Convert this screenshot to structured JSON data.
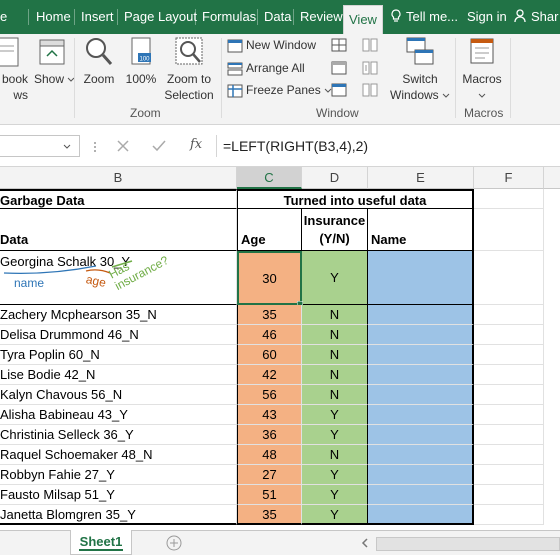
{
  "ribbon_tabs": {
    "file_partial": "e",
    "home": "Home",
    "insert": "Insert",
    "page_layout": "Page Layout",
    "formulas": "Formulas",
    "data": "Data",
    "review": "Review",
    "view": "View",
    "tell_me": "Tell me...",
    "sign_in": "Sign in",
    "share_partial": "Shar"
  },
  "ribbon": {
    "book_views_partial": "book",
    "book_views_partial2": "ws",
    "show": "Show",
    "zoom": "Zoom",
    "zoom_100": "100%",
    "zoom_to_selection_1": "Zoom to",
    "zoom_to_selection_2": "Selection",
    "zoom_group": "Zoom",
    "new_window": "New Window",
    "arrange_all": "Arrange All",
    "freeze_panes": "Freeze Panes",
    "switch_windows_1": "Switch",
    "switch_windows_2": "Windows",
    "window_group": "Window",
    "macros": "Macros",
    "macros_group": "Macros"
  },
  "formula_bar": {
    "fx": "fx",
    "formula": "=LEFT(RIGHT(B3,4),2)"
  },
  "columns": [
    "B",
    "C",
    "D",
    "E",
    "F"
  ],
  "header_row": {
    "garbage_data": "Garbage Data",
    "turned_into": "Turned into useful data"
  },
  "subheaders": {
    "data": "Data",
    "age": "Age",
    "insurance_1": "Insurance",
    "insurance_2": "(Y/N)",
    "name": "Name"
  },
  "example_row": {
    "data": "Georgina Schalk 30_Y",
    "age": "30",
    "insurance": "Y",
    "annotation_name": "name",
    "annotation_age": "age",
    "annotation_has": "Has",
    "annotation_insurance": "insurance?"
  },
  "rows": [
    {
      "data": "Zachery Mcphearson 35_N",
      "age": "35",
      "ins": "N"
    },
    {
      "data": "Delisa Drummond 46_N",
      "age": "46",
      "ins": "N"
    },
    {
      "data": "Tyra Poplin 60_N",
      "age": "60",
      "ins": "N"
    },
    {
      "data": "Lise Bodie 42_N",
      "age": "42",
      "ins": "N"
    },
    {
      "data": "Kalyn Chavous 56_N",
      "age": "56",
      "ins": "N"
    },
    {
      "data": "Alisha Babineau 43_Y",
      "age": "43",
      "ins": "Y"
    },
    {
      "data": "Christinia Selleck 36_Y",
      "age": "36",
      "ins": "Y"
    },
    {
      "data": "Raquel Schoemaker 48_N",
      "age": "48",
      "ins": "N"
    },
    {
      "data": "Robbyn Fahie 27_Y",
      "age": "27",
      "ins": "Y"
    },
    {
      "data": "Fausto Milsap 51_Y",
      "age": "51",
      "ins": "Y"
    },
    {
      "data": "Janetta Blomgren 35_Y",
      "age": "35",
      "ins": "Y"
    }
  ],
  "sheet_tab": "Sheet1",
  "colors": {
    "excel_green": "#217346",
    "age_fill": "#f4b183",
    "insurance_fill": "#a9d18e",
    "name_fill": "#9dc3e6"
  }
}
